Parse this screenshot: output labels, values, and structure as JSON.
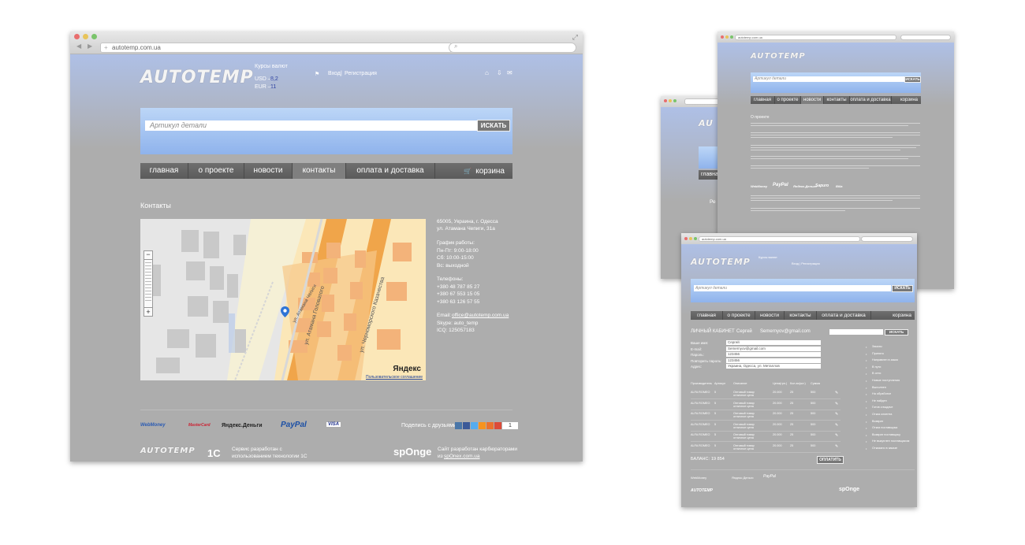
{
  "main": {
    "url": "autotemp.com.ua",
    "logo": "AUTOTEMP",
    "currency": {
      "title": "Курсы валют",
      "usd_label": "USD —",
      "usd_value": "8,2",
      "eur_label": "EUR —",
      "eur_value": "11"
    },
    "auth": {
      "login": "Вход",
      "sep": "|",
      "register": "Регистрация"
    },
    "search": {
      "placeholder": "Артикул детали",
      "button": "ИСКАТЬ"
    },
    "nav": [
      "главная",
      "о проекте",
      "новости",
      "контакты",
      "оплата и доставка"
    ],
    "cart": "корзина",
    "page_title": "Контакты",
    "map": {
      "zoom_minus": "−",
      "zoom_plus": "+",
      "yandex": "Яндекс",
      "agreement": "Пользовательское соглашение",
      "streets": [
        "ул. Атамана Головатого",
        "ул. Черноморского Казачества",
        "ул. Атамана Чепиги"
      ]
    },
    "contact": {
      "address1": "65005, Украина, г. Одесса",
      "address2": "ул. Атамана Чепиги, 31а",
      "hours_title": "График работы:",
      "hours": [
        "Пн-Пт: 9:00-18:00",
        "Сб: 10:00-15:00",
        "Вс: выходной"
      ],
      "phones_title": "Телефоны:",
      "phones": [
        "+380 48 787 85 27",
        "+380 67 553 15 05",
        "+380 63 126 57 55"
      ],
      "email_label": "Email:",
      "email": "office@autotemp.com.ua",
      "skype": "Skype: auto_temp",
      "icq": "ICQ: 125057183"
    },
    "footer": {
      "payments": [
        "WebMoney",
        "MasterCard",
        "Яндекс.Деньги",
        "PayPal",
        "VISA"
      ],
      "share": "Поделись с друзьями:",
      "share_count": "1",
      "dev_1c": "Сервис разработан с\nиспользованием технологии 1С",
      "sponge_logo": "spOnge",
      "sponge_text": "Сайт разработан карбюраторами\nиз",
      "sponge_link": "spOnex.com.ua"
    }
  },
  "second": {
    "url": "autotemp.com.ua",
    "nav": [
      "главная",
      "о проекте",
      "новости",
      "контакты",
      "оплата и доставка"
    ],
    "cart": "корзина",
    "about_title": "О проекте",
    "payments": [
      "WebMoney",
      "PayPal",
      "Яндекс.Деньги",
      "Sapuro",
      "Billa"
    ]
  },
  "third": {
    "url": "autotemp.com.ua",
    "nav": [
      "главная",
      "о проекте",
      "новости",
      "контакты",
      "оплата и доставка"
    ],
    "cart": "корзина",
    "cabinet_title": "ЛИЧНЫЙ КАБИНЕТ",
    "user_name": "Сергей",
    "user_email": "Semernyov@gmail.com",
    "search_button": "ИСКАТЬ",
    "form": [
      {
        "label": "Ваше имя:",
        "value": "Сергей"
      },
      {
        "label": "E-mail:",
        "value": "Semernyov@gmail.com"
      },
      {
        "label": "Пароль:",
        "value": "123456"
      },
      {
        "label": "Повторить пароль:",
        "value": "123456"
      },
      {
        "label": "Адрес:",
        "value": "Украина, Одесса, ул. Металлов"
      }
    ],
    "table_headers": [
      "Производитель",
      "Артикул",
      "Описание",
      "Цена(грн.)",
      "Кол-во(шт.)",
      "Сумма"
    ],
    "rows": [
      {
        "maker": "ALFA ROMEO",
        "art": "5",
        "desc": "Оптовый товар\nотличное цена",
        "price": "20.000",
        "qty": "25",
        "sum": "500"
      },
      {
        "maker": "ALFA ROMEO",
        "art": "5",
        "desc": "Оптовый товар\nотличное цена",
        "price": "20.000",
        "qty": "25",
        "sum": "500"
      },
      {
        "maker": "ALFA ROMEO",
        "art": "5",
        "desc": "Оптовый товар\nотличное цена",
        "price": "20.000",
        "qty": "25",
        "sum": "500"
      },
      {
        "maker": "ALFA ROMEO",
        "art": "5",
        "desc": "Оптовый товар\nотличное цена",
        "price": "20.000",
        "qty": "25",
        "sum": "500"
      },
      {
        "maker": "ALFA ROMEO",
        "art": "5",
        "desc": "Оптовый товар\nотличное цена",
        "price": "20.000",
        "qty": "25",
        "sum": "500"
      },
      {
        "maker": "ALFA ROMEO",
        "art": "5",
        "desc": "Оптовый товар\nотличное цена",
        "price": "20.000",
        "qty": "25",
        "sum": "500"
      }
    ],
    "balance_label": "БАЛАНС:",
    "balance_value": "19 854",
    "pay_button": "ОПЛАТИТЬ",
    "sidebar": [
      "Заказы",
      "Принято",
      "Направлен в заказ",
      "В пути",
      "В сети",
      "Новые поступления",
      "Выполнен",
      "На обработке",
      "Не найден",
      "Готов к выдаче",
      "Отказ клиента",
      "Возврат",
      "Отказ поставщика",
      "Возврат поставщику",
      "Не выкуплен поставщиком",
      "Отказано в заказе"
    ]
  },
  "colors": {
    "accent": "#8fb3ec",
    "nav": "#5e5e5e",
    "page": "#adadad",
    "link": "#ffffff"
  }
}
